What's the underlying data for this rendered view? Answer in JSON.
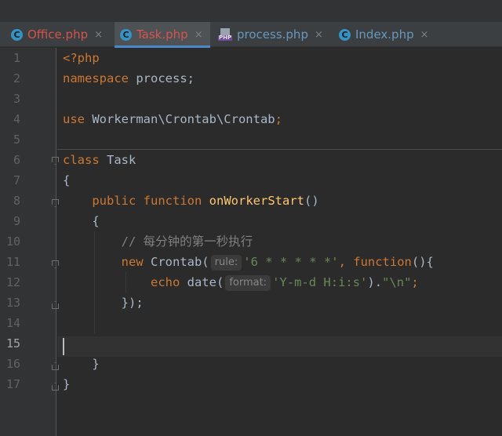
{
  "tabs": [
    {
      "label": "Office.php",
      "icon": "class-icon",
      "icon_glyph": "C",
      "color": "#d4534d",
      "active": false
    },
    {
      "label": "Task.php",
      "icon": "class-icon",
      "icon_glyph": "C",
      "color": "#d4534d",
      "active": true
    },
    {
      "label": "process.php",
      "icon": "php-file-icon",
      "icon_glyph": "PHP",
      "color": "#6897bb",
      "active": false
    },
    {
      "label": "Index.php",
      "icon": "class-icon",
      "icon_glyph": "C",
      "color": "#6897bb",
      "active": false
    }
  ],
  "close_glyph": "×",
  "line_numbers": [
    "1",
    "2",
    "3",
    "4",
    "5",
    "6",
    "7",
    "8",
    "9",
    "10",
    "11",
    "12",
    "13",
    "14",
    "15",
    "16",
    "17"
  ],
  "current_line": 15,
  "code": {
    "l1": "<?php",
    "l2_kw": "namespace",
    "l2_name": " process;",
    "l4_kw": "use",
    "l4_path": " Workerman\\Crontab\\Crontab",
    "l4_semi": ";",
    "l6_kw": "class",
    "l6_name": " Task",
    "l7": "{",
    "l8_kw1": "public",
    "l8_kw2": "function",
    "l8_fn": "onWorkerStart",
    "l8_paren": "()",
    "l9": "{",
    "l10_comment": "// 每分钟的第一秒执行",
    "l11_kw": "new",
    "l11_cls": " Crontab(",
    "l11_hint": "rule:",
    "l11_str": "'6 * * * * *'",
    "l11_sep": ", ",
    "l11_kw2": "function",
    "l11_tail": "(){",
    "l12_kw": "echo",
    "l12_fn": " date(",
    "l12_hint": "format:",
    "l12_str": "'Y-m-d H:i:s'",
    "l12_close": ").",
    "l12_str2": "\"\\n\"",
    "l12_semi": ";",
    "l13": "});",
    "l16": "}",
    "l17": "}"
  },
  "colors": {
    "keyword": "#cc7832",
    "string": "#6a8759",
    "comment": "#808080",
    "text": "#a9b7c6",
    "background": "#2b2b2b"
  }
}
